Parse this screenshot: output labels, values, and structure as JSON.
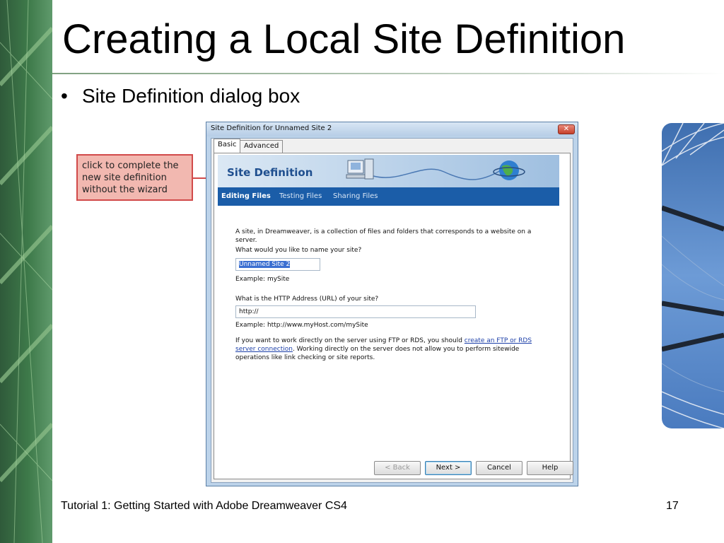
{
  "slide": {
    "title": "Creating a Local Site Definition",
    "bullet": "Site Definition dialog box",
    "footer": "Tutorial 1: Getting Started with Adobe Dreamweaver CS4",
    "page_number": "17"
  },
  "callout": {
    "line1": "click to complete the",
    "line2": "new site definition",
    "line3": "without the wizard"
  },
  "dialog": {
    "title": "Site Definition for Unnamed Site 2",
    "close_symbol": "✕",
    "tabs": {
      "basic": "Basic",
      "advanced": "Advanced"
    },
    "banner_title": "Site Definition",
    "subtabs": {
      "editing": "Editing Files",
      "testing": "Testing Files",
      "sharing": "Sharing Files"
    },
    "intro_line1": "A site, in Dreamweaver, is a collection of files and folders that corresponds to a website on a",
    "intro_line2": "server.",
    "name_question": "What would you like to name your site?",
    "site_name_value": "Unnamed Site 2",
    "name_example": "Example: mySite",
    "url_question": "What is the HTTP Address (URL) of your site?",
    "url_value": "http://",
    "url_example": "Example: http://www.myHost.com/mySite",
    "ftp_text_before": "If you want to work directly on the server using FTP or RDS, you should ",
    "ftp_link_part1": "create an FTP or RDS",
    "ftp_link_part2": "server connection",
    "ftp_text_after": ".  Working directly on the server does not allow you to perform sitewide",
    "ftp_text_line3": "operations like link checking or site reports.",
    "buttons": {
      "back": "< Back",
      "next": "Next >",
      "cancel": "Cancel",
      "help": "Help"
    }
  },
  "colors": {
    "accent_blue": "#1b5da8",
    "callout_fill": "#f2b8b0",
    "callout_border": "#d14a4a"
  }
}
